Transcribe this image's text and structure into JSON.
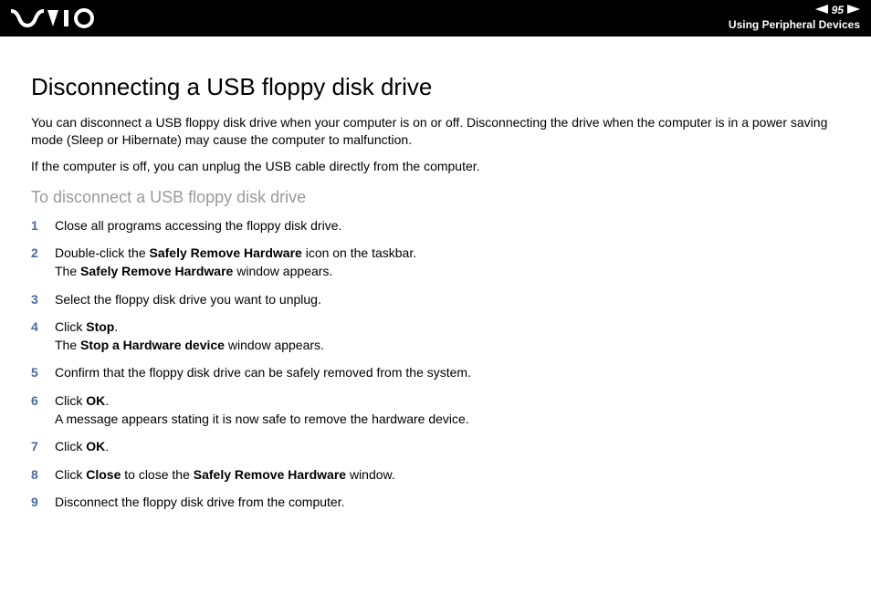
{
  "header": {
    "page_number": "95",
    "section": "Using Peripheral Devices"
  },
  "title": "Disconnecting a USB floppy disk drive",
  "intro": {
    "p1": "You can disconnect a USB floppy disk drive when your computer is on or off. Disconnecting the drive when the computer is in a power saving mode (Sleep or Hibernate) may cause the computer to malfunction.",
    "p2": "If the computer is off, you can unplug the USB cable directly from the computer."
  },
  "subheading": "To disconnect a USB floppy disk drive",
  "steps": [
    {
      "n": "1",
      "html": "Close all programs accessing the floppy disk drive."
    },
    {
      "n": "2",
      "html": "Double-click the <b>Safely Remove Hardware</b> icon on the taskbar.<br>The <b>Safely Remove Hardware</b> window appears."
    },
    {
      "n": "3",
      "html": "Select the floppy disk drive you want to unplug."
    },
    {
      "n": "4",
      "html": "Click <b>Stop</b>.<br>The <b>Stop a Hardware device</b> window appears."
    },
    {
      "n": "5",
      "html": "Confirm that the floppy disk drive can be safely removed from the system."
    },
    {
      "n": "6",
      "html": "Click <b>OK</b>.<br>A message appears stating it is now safe to remove the hardware device."
    },
    {
      "n": "7",
      "html": "Click <b>OK</b>."
    },
    {
      "n": "8",
      "html": "Click <b>Close</b> to close the <b>Safely Remove Hardware</b> window."
    },
    {
      "n": "9",
      "html": "Disconnect the floppy disk drive from the computer."
    }
  ]
}
